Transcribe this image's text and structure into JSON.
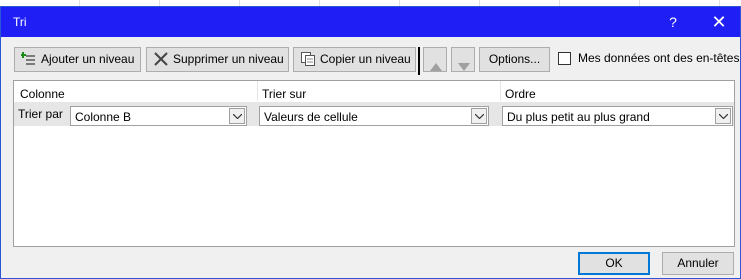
{
  "dialog": {
    "title": "Tri",
    "help_label": "?",
    "close_label": "✕"
  },
  "toolbar": {
    "add_level_label": "Ajouter un niveau",
    "delete_level_label": "Supprimer un niveau",
    "copy_level_label": "Copier un niveau",
    "options_label": "Options...",
    "headers_checkbox_label": "Mes données ont des en-têtes",
    "headers_checked": false
  },
  "grid": {
    "columns": [
      "Colonne",
      "Trier sur",
      "Ordre"
    ],
    "rows": [
      {
        "label": "Trier par",
        "column": "Colonne B",
        "sort_on": "Valeurs de cellule",
        "order": "Du plus petit au plus grand"
      }
    ]
  },
  "footer": {
    "ok_label": "OK",
    "cancel_label": "Annuler"
  },
  "colors": {
    "titlebar": "#1e1ef5",
    "dialog_bg": "#f0f0f0",
    "selected_row": "#e6e6e6",
    "default_button_border": "#0078d7"
  },
  "icons": [
    "add-level-icon",
    "delete-level-icon",
    "copy-level-icon",
    "move-up-icon",
    "move-down-icon",
    "dropdown-arrow-icon"
  ]
}
